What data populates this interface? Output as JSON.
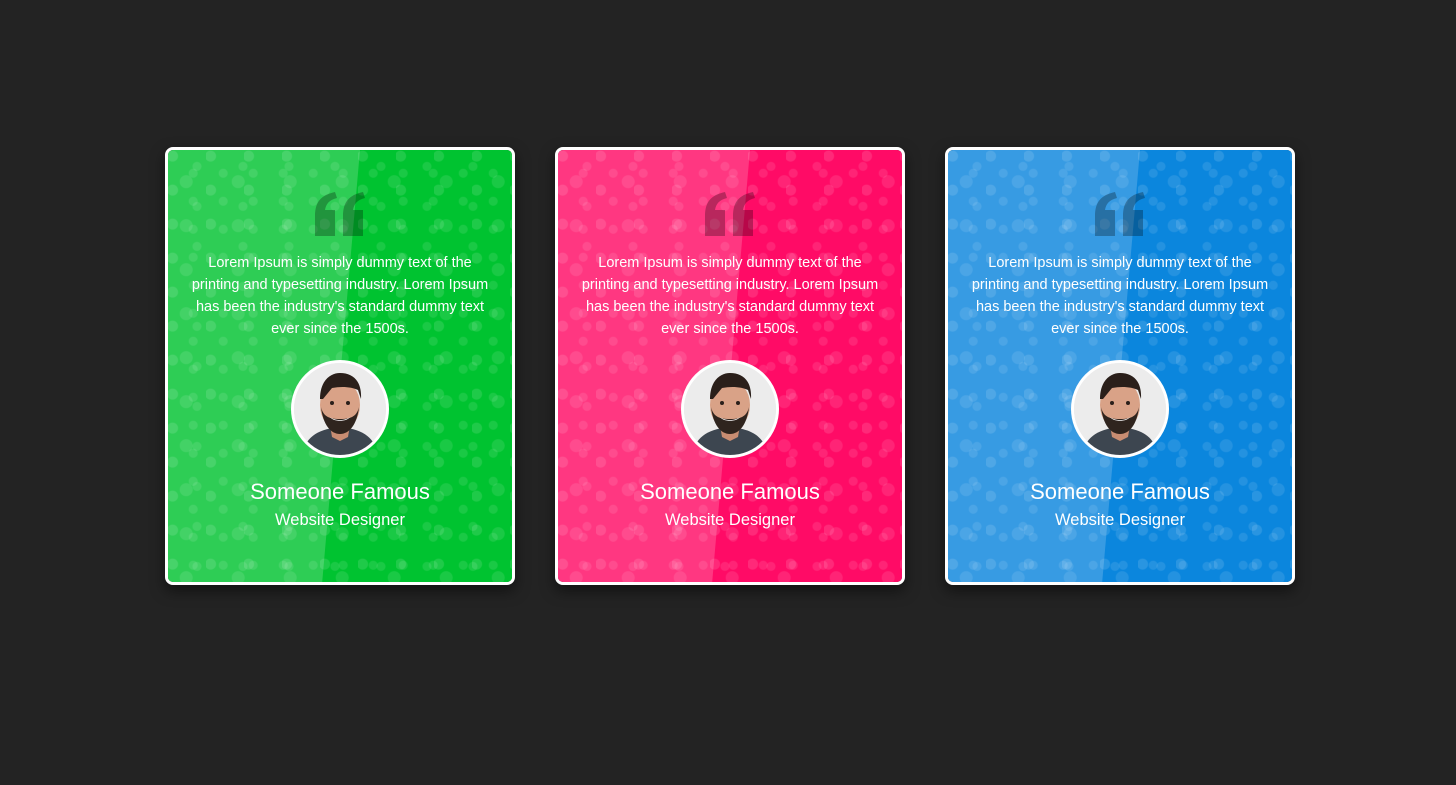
{
  "cards": [
    {
      "color": "#00c330",
      "quote_icon": "quote-left-icon",
      "quote": "Lorem Ipsum is simply dummy text of the printing and typesetting industry. Lorem Ipsum has been the industry's standard dummy text ever since the 1500s.",
      "avatar_icon": "person-avatar",
      "name": "Someone Famous",
      "role": "Website Designer"
    },
    {
      "color": "#ff0b66",
      "quote_icon": "quote-left-icon",
      "quote": "Lorem Ipsum is simply dummy text of the printing and typesetting industry. Lorem Ipsum has been the industry's standard dummy text ever since the 1500s.",
      "avatar_icon": "person-avatar",
      "name": "Someone Famous",
      "role": "Website Designer"
    },
    {
      "color": "#0b86dd",
      "quote_icon": "quote-left-icon",
      "quote": "Lorem Ipsum is simply dummy text of the printing and typesetting industry. Lorem Ipsum has been the industry's standard dummy text ever since the 1500s.",
      "avatar_icon": "person-avatar",
      "name": "Someone Famous",
      "role": "Website Designer"
    }
  ],
  "colors": {
    "page_background": "#232323",
    "card_border": "#ffffff",
    "text": "#ffffff"
  }
}
